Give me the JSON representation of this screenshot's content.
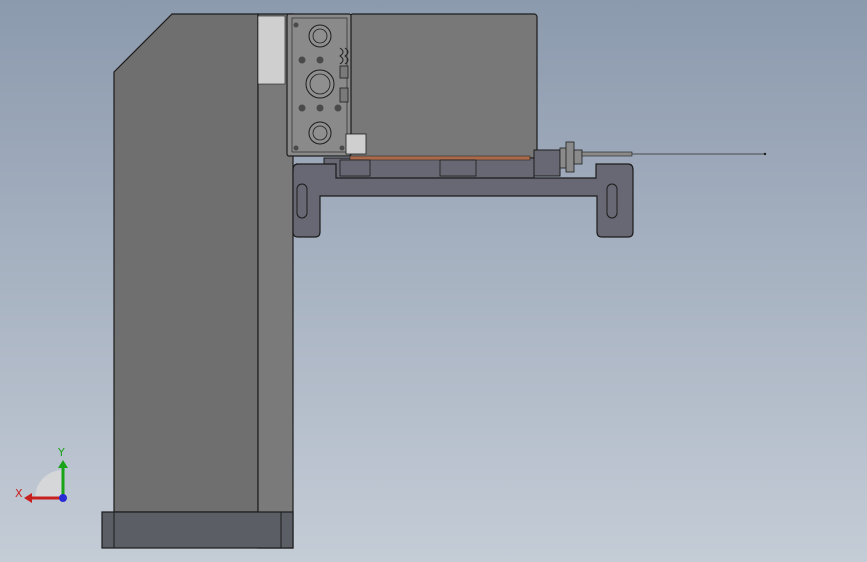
{
  "viewport": {
    "background_top": "#8c9aae",
    "background_bottom": "#c4ccd6"
  },
  "colors": {
    "column_face": "#6f6f6f",
    "column_side": "#7a7a7a",
    "base_block": "#5c5e66",
    "head_housing": "#787878",
    "side_plate": "#8a8a8a",
    "bracket": "#676873",
    "edge": "#1c1c1c",
    "light_strip": "#cfcfcf",
    "copper_strip": "#a86a4a"
  },
  "triad": {
    "x_label": "X",
    "y_label": "Y",
    "x_color": "#c8201f",
    "y_color": "#19a319",
    "z_color": "#2b2bd6"
  }
}
